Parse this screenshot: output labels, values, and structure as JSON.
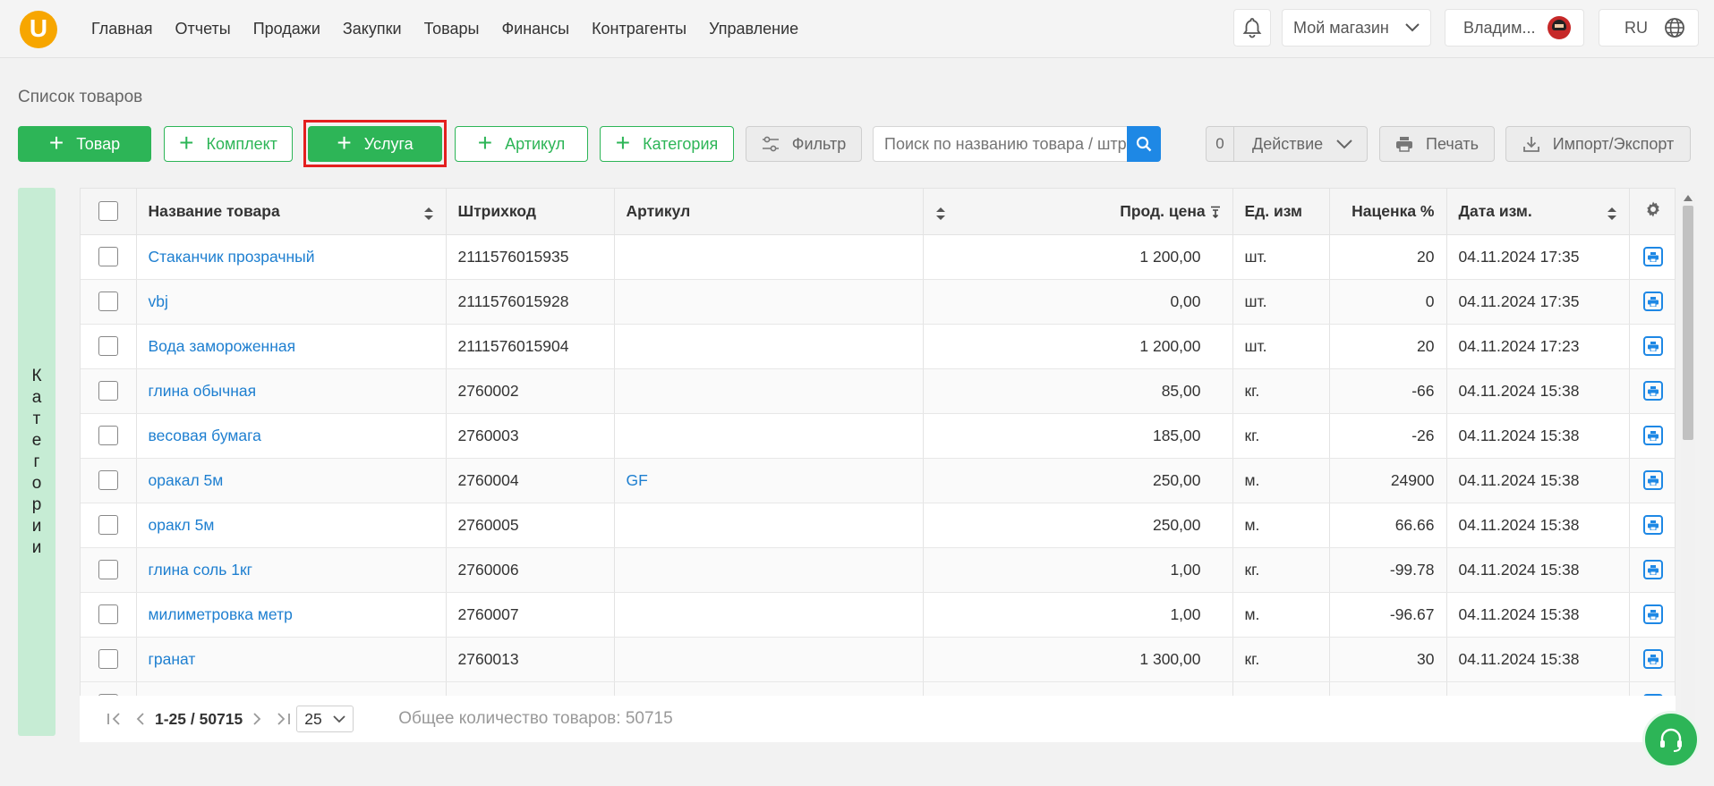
{
  "logo_letter": "U",
  "nav": [
    "Главная",
    "Отчеты",
    "Продажи",
    "Закупки",
    "Товары",
    "Финансы",
    "Контрагенты",
    "Управление"
  ],
  "header": {
    "store": "Мой магазин",
    "user": "Владим...",
    "lang": "RU"
  },
  "page_title": "Список товаров",
  "toolbar": {
    "add_product": "Товар",
    "add_kit": "Комплект",
    "add_service": "Услуга",
    "add_sku": "Артикул",
    "add_category": "Категория",
    "filter": "Фильтр",
    "search_placeholder": "Поиск по названию товара / штрихкоду",
    "selected_count": "0",
    "action": "Действие",
    "print": "Печать",
    "import_export": "Импорт/Экспорт"
  },
  "side_panel_label": "Категории",
  "table": {
    "headers": {
      "name": "Название товара",
      "barcode": "Штрихкод",
      "sku": "Артикул",
      "price": "Прод. цена",
      "unit": "Ед. изм",
      "markup": "Наценка %",
      "date": "Дата изм."
    },
    "rows": [
      {
        "name": "Стаканчик прозрачный",
        "barcode": "2111576015935",
        "sku": "",
        "price": "1 200,00",
        "unit": "шт.",
        "markup": "20",
        "date": "04.11.2024 17:35"
      },
      {
        "name": "vbj",
        "barcode": "2111576015928",
        "sku": "",
        "price": "0,00",
        "unit": "шт.",
        "markup": "0",
        "date": "04.11.2024 17:35"
      },
      {
        "name": "Вода замороженная",
        "barcode": "2111576015904",
        "sku": "",
        "price": "1 200,00",
        "unit": "шт.",
        "markup": "20",
        "date": "04.11.2024 17:23"
      },
      {
        "name": "глина обычная",
        "barcode": "2760002",
        "sku": "",
        "price": "85,00",
        "unit": "кг.",
        "markup": "-66",
        "date": "04.11.2024 15:38"
      },
      {
        "name": "весовая бумага",
        "barcode": "2760003",
        "sku": "",
        "price": "185,00",
        "unit": "кг.",
        "markup": "-26",
        "date": "04.11.2024 15:38"
      },
      {
        "name": "оракал 5м",
        "barcode": "2760004",
        "sku": "GF",
        "price": "250,00",
        "unit": "м.",
        "markup": "24900",
        "date": "04.11.2024 15:38"
      },
      {
        "name": "оракл 5м",
        "barcode": "2760005",
        "sku": "",
        "price": "250,00",
        "unit": "м.",
        "markup": "66.66",
        "date": "04.11.2024 15:38"
      },
      {
        "name": "глина соль 1кг",
        "barcode": "2760006",
        "sku": "",
        "price": "1,00",
        "unit": "кг.",
        "markup": "-99.78",
        "date": "04.11.2024 15:38"
      },
      {
        "name": "милиметровка метр",
        "barcode": "2760007",
        "sku": "",
        "price": "1,00",
        "unit": "м.",
        "markup": "-96.67",
        "date": "04.11.2024 15:38"
      },
      {
        "name": "гранат",
        "barcode": "2760013",
        "sku": "",
        "price": "1 300,00",
        "unit": "кг.",
        "markup": "30",
        "date": "04.11.2024 15:38"
      }
    ]
  },
  "pagination": {
    "range": "1-25 / 50715",
    "page_size": "25",
    "total": "Общее количество товаров: 50715"
  },
  "colors": {
    "brand_green": "#2db557",
    "link_blue": "#1e7fd0",
    "accent_blue": "#1e88e5",
    "logo_orange": "#f7a600",
    "highlight_red": "#e41f1f"
  }
}
